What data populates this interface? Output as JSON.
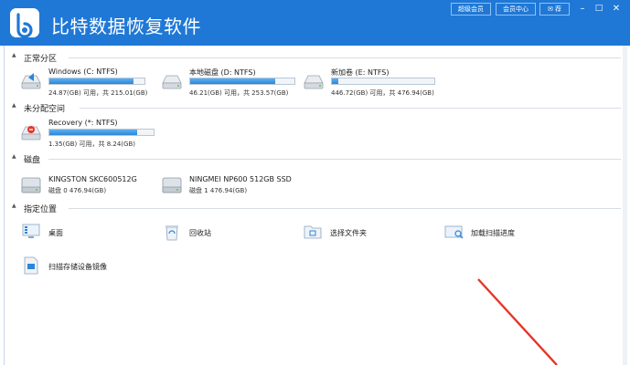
{
  "app": {
    "title": "比特数据恢复软件",
    "buttons": {
      "super_member": "超级会员",
      "member_center": "会员中心",
      "recommend": "荐"
    },
    "window_controls": {
      "minimize": "–",
      "maximize": "□",
      "close": "✕"
    }
  },
  "sections": {
    "partitions": {
      "label": "正常分区",
      "items": [
        {
          "name": "Windows (C: NTFS)",
          "info": "24.87(GB) 可用，共 215.01(GB)",
          "used_fraction": 0.88
        },
        {
          "name": "本地磁盘 (D: NTFS)",
          "info": "46.21(GB) 可用，共 253.57(GB)",
          "used_fraction": 0.82
        },
        {
          "name": "新加卷 (E: NTFS)",
          "info": "446.72(GB) 可用，共 476.94(GB)",
          "used_fraction": 0.06
        }
      ]
    },
    "unallocated": {
      "label": "未分配空间",
      "items": [
        {
          "name": "Recovery (*: NTFS)",
          "info": "1.35(GB) 可用，共 8.24(GB)",
          "used_fraction": 0.84
        }
      ]
    },
    "disks": {
      "label": "磁盘",
      "items": [
        {
          "name": "KINGSTON SKC600512G",
          "info": "磁盘 0   476.94(GB)"
        },
        {
          "name": "NINGMEI NP600 512GB SSD",
          "info": "磁盘 1   476.94(GB)"
        }
      ]
    },
    "locations": {
      "label": "指定位置",
      "items": [
        {
          "name": "桌面",
          "icon": "desktop-icon"
        },
        {
          "name": "回收站",
          "icon": "recycle-bin-icon"
        },
        {
          "name": "选择文件夹",
          "icon": "folder-icon"
        },
        {
          "name": "加载扫描进度",
          "icon": "load-scan-icon"
        },
        {
          "name": "扫描存储设备镜像",
          "icon": "disk-image-icon"
        }
      ]
    }
  },
  "colors": {
    "title_bar": "#1f78d6",
    "bar_fill": "#2c86d8",
    "annotation_arrow": "#e53528"
  }
}
